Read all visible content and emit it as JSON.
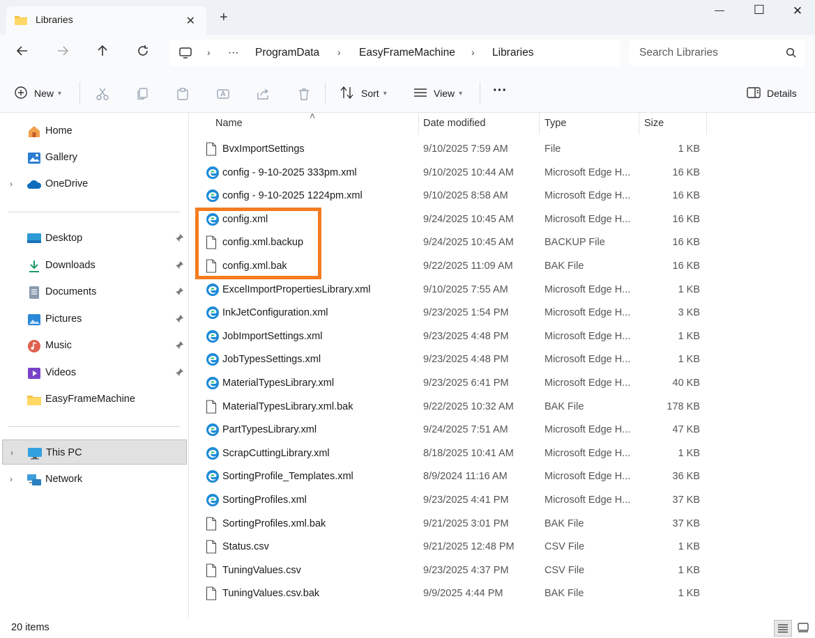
{
  "window": {
    "tab_title": "Libraries",
    "tab_close": "✕",
    "new_tab": "+",
    "minimize": "—",
    "maximize": "☐",
    "close": "✕"
  },
  "address": {
    "overflow": "···",
    "crumbs": [
      "ProgramData",
      "EasyFrameMachine",
      "Libraries"
    ],
    "separator": "›"
  },
  "search": {
    "placeholder": "Search Libraries"
  },
  "toolbar": {
    "new_label": "New",
    "sort_label": "Sort",
    "view_label": "View",
    "more": "···",
    "details_label": "Details"
  },
  "sidebar": {
    "expand": "›",
    "top": [
      {
        "label": "Home",
        "icon": "home-icon"
      },
      {
        "label": "Gallery",
        "icon": "gallery-icon"
      },
      {
        "label": "OneDrive",
        "icon": "cloud-icon"
      }
    ],
    "quick": [
      {
        "label": "Desktop",
        "icon": "desktop-icon",
        "pinned": true
      },
      {
        "label": "Downloads",
        "icon": "download-icon",
        "pinned": true
      },
      {
        "label": "Documents",
        "icon": "document-icon",
        "pinned": true
      },
      {
        "label": "Pictures",
        "icon": "picture-icon",
        "pinned": true
      },
      {
        "label": "Music",
        "icon": "music-icon",
        "pinned": true
      },
      {
        "label": "Videos",
        "icon": "video-icon",
        "pinned": true
      },
      {
        "label": "EasyFrameMachine",
        "icon": "folder-icon",
        "pinned": false
      }
    ],
    "devices": [
      {
        "label": "This PC",
        "icon": "computer-icon",
        "selected": true
      },
      {
        "label": "Network",
        "icon": "network-icon",
        "selected": false
      }
    ]
  },
  "columns": {
    "name": "Name",
    "date": "Date modified",
    "type": "Type",
    "size": "Size",
    "sort_indicator": "˄"
  },
  "files": [
    {
      "name": "BvxImportSettings",
      "date": "9/10/2025 7:59 AM",
      "type": "File",
      "size": "1 KB",
      "icon": "file"
    },
    {
      "name": "config - 9-10-2025 333pm.xml",
      "date": "9/10/2025 10:44 AM",
      "type": "Microsoft Edge H...",
      "size": "16 KB",
      "icon": "edge"
    },
    {
      "name": "config - 9-10-2025 1224pm.xml",
      "date": "9/10/2025 8:58 AM",
      "type": "Microsoft Edge H...",
      "size": "16 KB",
      "icon": "edge"
    },
    {
      "name": "config.xml",
      "date": "9/24/2025 10:45 AM",
      "type": "Microsoft Edge H...",
      "size": "16 KB",
      "icon": "edge"
    },
    {
      "name": "config.xml.backup",
      "date": "9/24/2025 10:45 AM",
      "type": "BACKUP File",
      "size": "16 KB",
      "icon": "file"
    },
    {
      "name": "config.xml.bak",
      "date": "9/22/2025 11:09 AM",
      "type": "BAK File",
      "size": "16 KB",
      "icon": "file"
    },
    {
      "name": "ExcelImportPropertiesLibrary.xml",
      "date": "9/10/2025 7:55 AM",
      "type": "Microsoft Edge H...",
      "size": "1 KB",
      "icon": "edge"
    },
    {
      "name": "InkJetConfiguration.xml",
      "date": "9/23/2025 1:54 PM",
      "type": "Microsoft Edge H...",
      "size": "3 KB",
      "icon": "edge"
    },
    {
      "name": "JobImportSettings.xml",
      "date": "9/23/2025 4:48 PM",
      "type": "Microsoft Edge H...",
      "size": "1 KB",
      "icon": "edge"
    },
    {
      "name": "JobTypesSettings.xml",
      "date": "9/23/2025 4:48 PM",
      "type": "Microsoft Edge H...",
      "size": "1 KB",
      "icon": "edge"
    },
    {
      "name": "MaterialTypesLibrary.xml",
      "date": "9/23/2025 6:41 PM",
      "type": "Microsoft Edge H...",
      "size": "40 KB",
      "icon": "edge"
    },
    {
      "name": "MaterialTypesLibrary.xml.bak",
      "date": "9/22/2025 10:32 AM",
      "type": "BAK File",
      "size": "178 KB",
      "icon": "file"
    },
    {
      "name": "PartTypesLibrary.xml",
      "date": "9/24/2025 7:51 AM",
      "type": "Microsoft Edge H...",
      "size": "47 KB",
      "icon": "edge"
    },
    {
      "name": "ScrapCuttingLibrary.xml",
      "date": "8/18/2025 10:41 AM",
      "type": "Microsoft Edge H...",
      "size": "1 KB",
      "icon": "edge"
    },
    {
      "name": "SortingProfile_Templates.xml",
      "date": "8/9/2024 11:16 AM",
      "type": "Microsoft Edge H...",
      "size": "36 KB",
      "icon": "edge"
    },
    {
      "name": "SortingProfiles.xml",
      "date": "9/23/2025 4:41 PM",
      "type": "Microsoft Edge H...",
      "size": "37 KB",
      "icon": "edge"
    },
    {
      "name": "SortingProfiles.xml.bak",
      "date": "9/21/2025 3:01 PM",
      "type": "BAK File",
      "size": "37 KB",
      "icon": "file"
    },
    {
      "name": "Status.csv",
      "date": "9/21/2025 12:48 PM",
      "type": "CSV File",
      "size": "1 KB",
      "icon": "file"
    },
    {
      "name": "TuningValues.csv",
      "date": "9/23/2025 4:37 PM",
      "type": "CSV File",
      "size": "1 KB",
      "icon": "file"
    },
    {
      "name": "TuningValues.csv.bak",
      "date": "9/9/2025 4:44 PM",
      "type": "BAK File",
      "size": "1 KB",
      "icon": "file"
    }
  ],
  "status": {
    "count": "20 items"
  },
  "colors": {
    "highlight": "#f47c20",
    "accent": "#0067c0"
  }
}
